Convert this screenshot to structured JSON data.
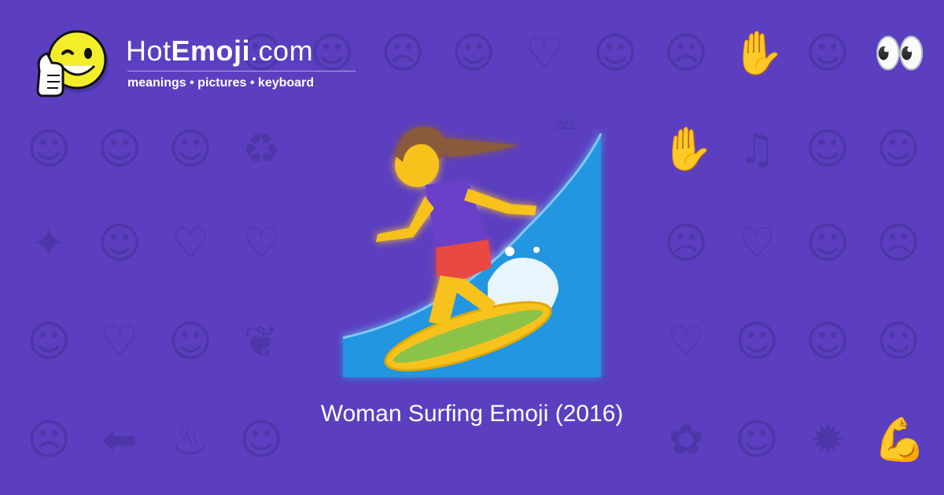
{
  "brand": {
    "name_prefix": "Hot",
    "name_bold": "Emoji",
    "name_suffix": ".com",
    "tagline": "meanings • pictures • keyboard"
  },
  "hero": {
    "icon": "woman-surfing-emoji",
    "caption": "Woman Surfing Emoji (2016)"
  },
  "background_icons": [
    "☺",
    "☺",
    "☹",
    "☺",
    "♡",
    "☺",
    "☹",
    "✋",
    "☺",
    "👀",
    "☺",
    "☺",
    "☺",
    "♻",
    "✋",
    "♫",
    "☺",
    "☺",
    "✦",
    "☺",
    "♡",
    "♡",
    "☹",
    "♡",
    "☺",
    "☹",
    "☺",
    "♡",
    "☺",
    "❦",
    "♡",
    "☺",
    "☺",
    "☺",
    "☹",
    "⬅",
    "♨",
    "☺",
    "✿",
    "☺",
    "✹",
    "💪",
    "♡",
    "✔",
    "☺",
    "☺",
    "✋",
    "📷",
    "☹",
    "☺",
    "♡",
    "☺",
    "☺"
  ],
  "colors": {
    "background": "#5b3fc0",
    "pattern": "#4f36a8",
    "wave": "#2196e0",
    "skin": "#f7c21a",
    "hair": "#8a5a3c",
    "shirt": "#6b3fc9",
    "shorts": "#e94a3f",
    "board": "#cddc39"
  }
}
